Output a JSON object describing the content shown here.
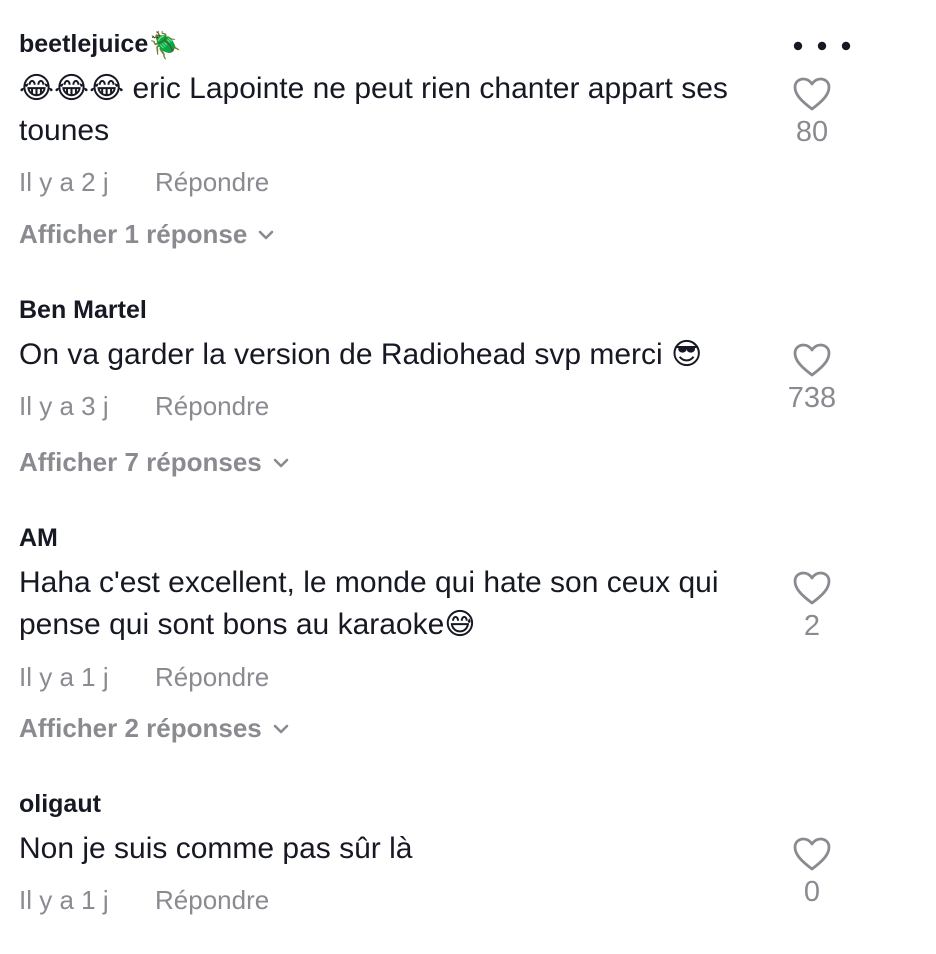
{
  "comments": [
    {
      "username": "beetlejuice",
      "username_badge": "🪲",
      "text": "😂😂😂 eric Lapointe ne peut rien chanter appart ses tounes",
      "time": "Il y a 2 j",
      "reply_label": "Répondre",
      "view_replies": "Afficher 1 réponse",
      "likes": "80"
    },
    {
      "username": "Ben Martel",
      "text": "On va garder la version de Radiohead svp merci 😎",
      "time": "Il y a 3 j",
      "reply_label": "Répondre",
      "view_replies": "Afficher 7 réponses",
      "likes": "738"
    },
    {
      "username": "AM",
      "text": "Haha c'est excellent, le monde qui hate son ceux qui pense qui sont bons au karaoke😅",
      "time": "Il y a 1 j",
      "reply_label": "Répondre",
      "view_replies": "Afficher 2 réponses",
      "likes": "2"
    },
    {
      "username": "oligaut",
      "text": "Non je suis comme pas sûr là",
      "time": "Il y a 1 j",
      "reply_label": "Répondre",
      "likes": "0"
    }
  ],
  "icons": {
    "like": "heart-outline-icon",
    "more": "more-horizontal-icon",
    "expand": "chevron-down-icon"
  },
  "colors": {
    "primary_text": "#161823",
    "secondary_text": "#8a8b91",
    "background": "#ffffff"
  }
}
